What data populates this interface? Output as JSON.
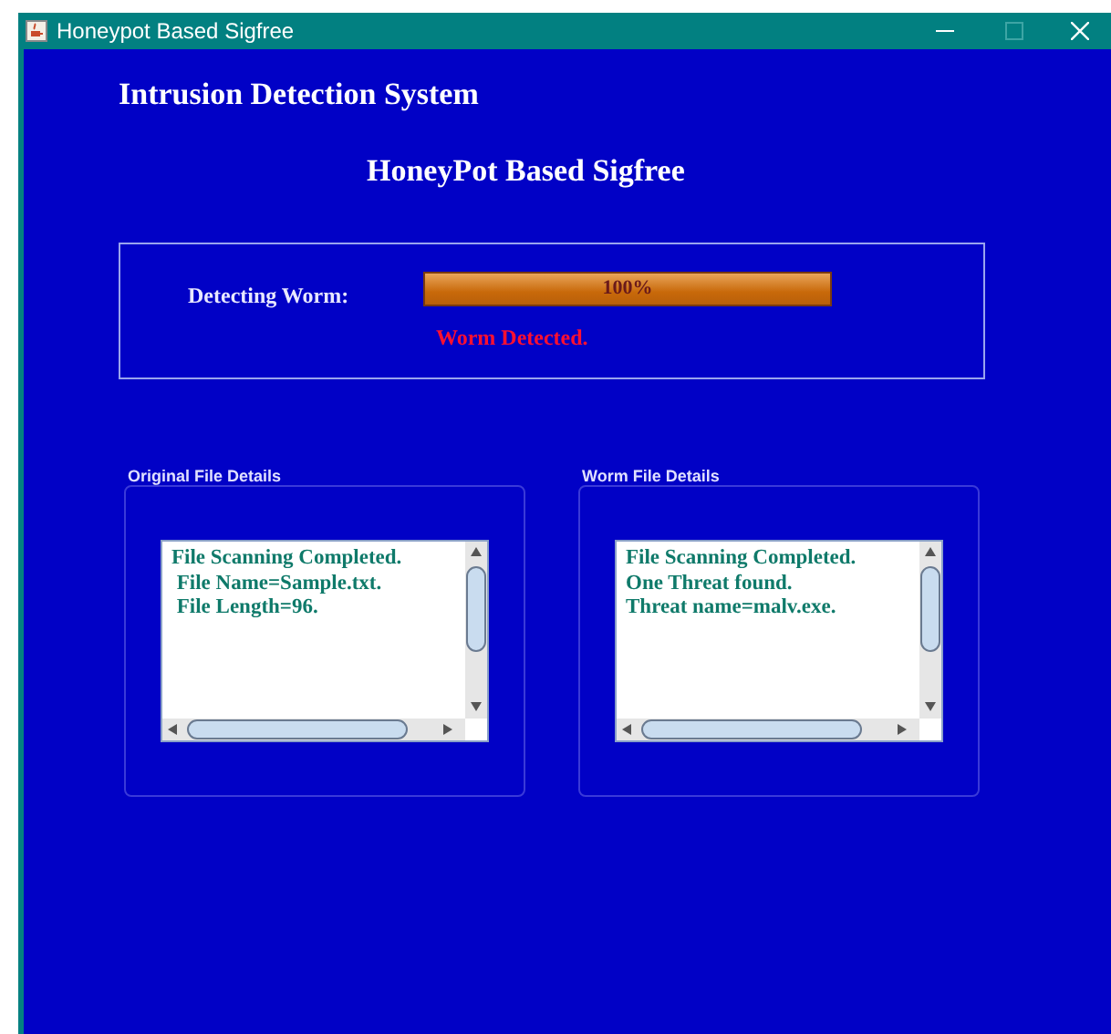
{
  "window": {
    "title": "Honeypot Based Sigfree"
  },
  "heading": "Intrusion Detection System",
  "subheading": "HoneyPot Based Sigfree",
  "detection": {
    "label": "Detecting Worm:",
    "progress": {
      "level": 1.0,
      "text": "100%"
    },
    "result": "Worm Detected."
  },
  "panels": [
    {
      "title": "Original File Details",
      "lines": [
        "File Scanning Completed.",
        " File Name=Sample.txt.",
        " File Length=96."
      ]
    },
    {
      "title": "Worm File Details",
      "lines": [
        "File Scanning Completed.",
        "One Threat found.",
        "Threat name=malv.exe."
      ]
    }
  ]
}
